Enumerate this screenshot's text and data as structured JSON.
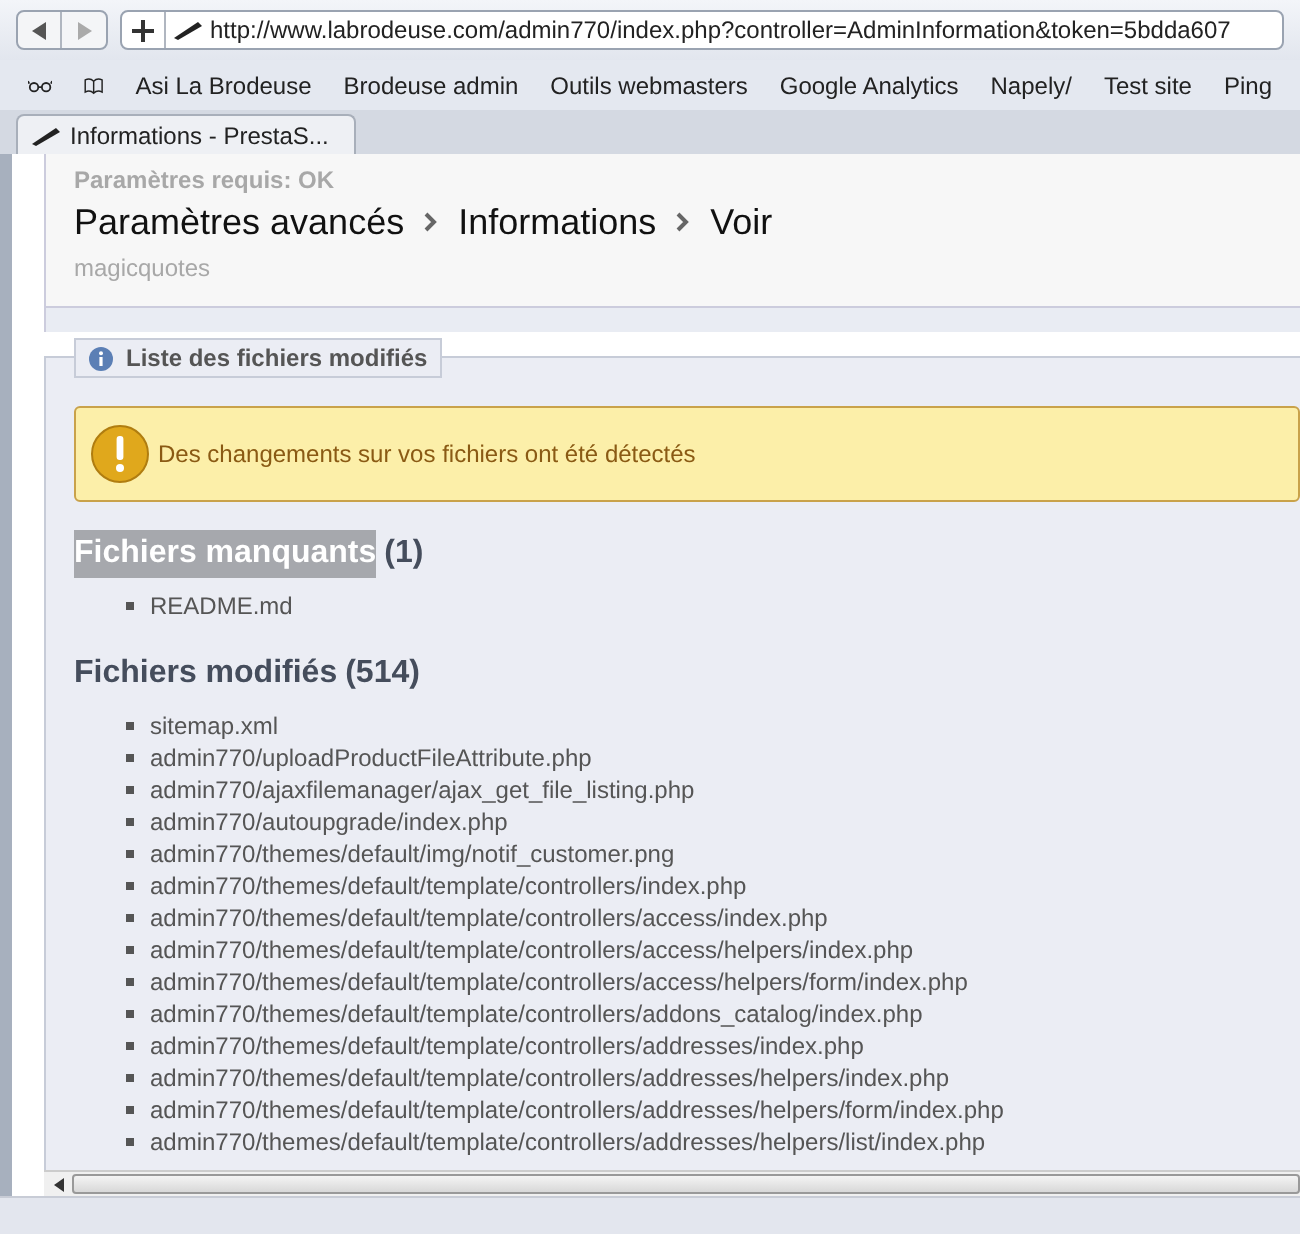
{
  "browser": {
    "url": "http://www.labrodeuse.com/admin770/index.php?controller=AdminInformation&token=5bdda607",
    "bookmarks": [
      "Asi La Brodeuse",
      "Brodeuse admin",
      "Outils webmasters",
      "Google Analytics",
      "Napely/",
      "Test site",
      "Ping"
    ],
    "tab": "Informations - PrestaS..."
  },
  "faded_lines": [
    "Paramètres requis: OK",
    "magicquotes"
  ],
  "breadcrumb": [
    "Paramètres avancés",
    "Informations",
    "Voir"
  ],
  "panel": {
    "legend": "Liste des fichiers modifiés",
    "warning": "Des changements sur vos fichiers ont été détectés",
    "sections": [
      {
        "title": "Fichiers manquants",
        "count": "(1)",
        "highlighted": true,
        "files": [
          "README.md"
        ]
      },
      {
        "title": "Fichiers modifiés",
        "count": "(514)",
        "highlighted": false,
        "files": [
          "sitemap.xml",
          "admin770/uploadProductFileAttribute.php",
          "admin770/ajaxfilemanager/ajax_get_file_listing.php",
          "admin770/autoupgrade/index.php",
          "admin770/themes/default/img/notif_customer.png",
          "admin770/themes/default/template/controllers/index.php",
          "admin770/themes/default/template/controllers/access/index.php",
          "admin770/themes/default/template/controllers/access/helpers/index.php",
          "admin770/themes/default/template/controllers/access/helpers/form/index.php",
          "admin770/themes/default/template/controllers/addons_catalog/index.php",
          "admin770/themes/default/template/controllers/addresses/index.php",
          "admin770/themes/default/template/controllers/addresses/helpers/index.php",
          "admin770/themes/default/template/controllers/addresses/helpers/form/index.php",
          "admin770/themes/default/template/controllers/addresses/helpers/list/index.php"
        ]
      }
    ]
  }
}
